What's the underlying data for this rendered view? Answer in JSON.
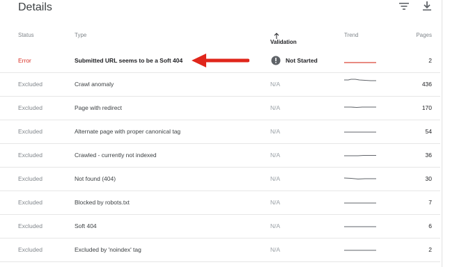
{
  "title": "Details",
  "toolbar": {
    "filter_icon": "filter-icon",
    "download_icon": "download-icon"
  },
  "columns": {
    "status": "Status",
    "type": "Type",
    "validation": "Validation",
    "trend": "Trend",
    "pages": "Pages"
  },
  "colors": {
    "error": "#d93025",
    "error_trend": "#db4437",
    "trend": "#5f6368",
    "arrow": "#e0261b"
  },
  "rows": [
    {
      "status": "Error",
      "type": "Submitted URL seems to be a Soft 404",
      "validation": "Not Started",
      "pages": "2"
    },
    {
      "status": "Excluded",
      "type": "Crawl anomaly",
      "validation": "N/A",
      "pages": "436"
    },
    {
      "status": "Excluded",
      "type": "Page with redirect",
      "validation": "N/A",
      "pages": "170"
    },
    {
      "status": "Excluded",
      "type": "Alternate page with proper canonical tag",
      "validation": "N/A",
      "pages": "54"
    },
    {
      "status": "Excluded",
      "type": "Crawled - currently not indexed",
      "validation": "N/A",
      "pages": "36"
    },
    {
      "status": "Excluded",
      "type": "Not found (404)",
      "validation": "N/A",
      "pages": "30"
    },
    {
      "status": "Excluded",
      "type": "Blocked by robots.txt",
      "validation": "N/A",
      "pages": "7"
    },
    {
      "status": "Excluded",
      "type": "Soft 404",
      "validation": "N/A",
      "pages": "6"
    },
    {
      "status": "Excluded",
      "type": "Excluded by 'noindex' tag",
      "validation": "N/A",
      "pages": "2"
    }
  ]
}
